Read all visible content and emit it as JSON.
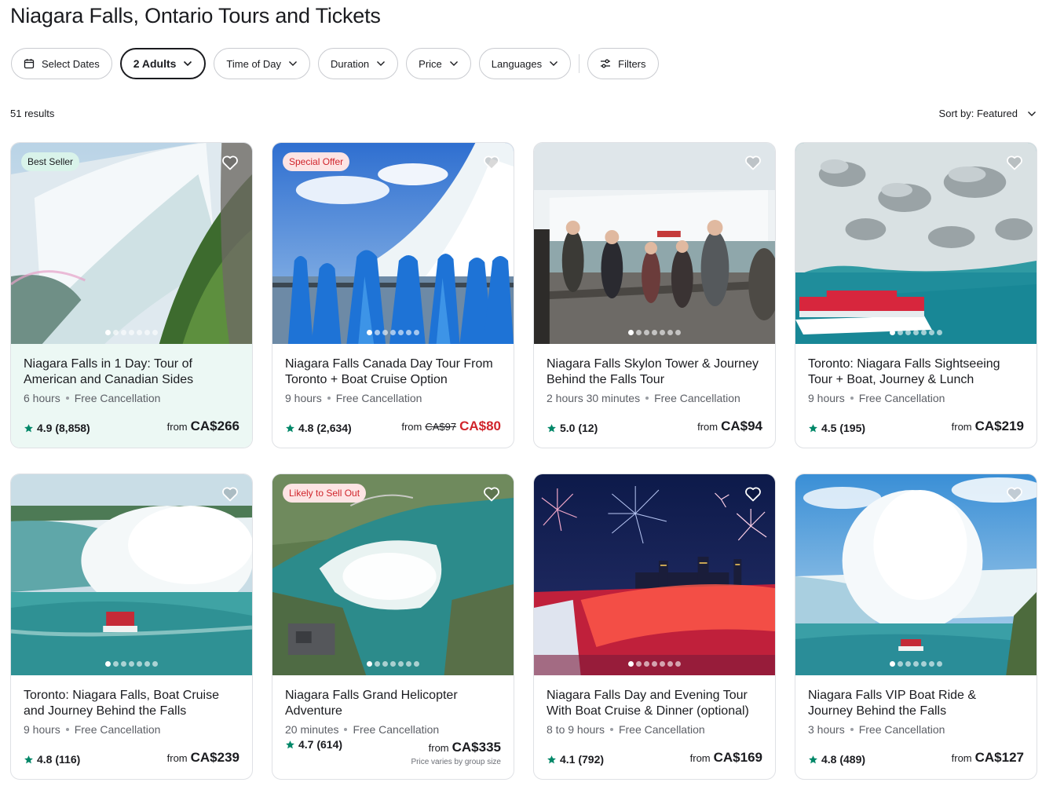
{
  "page_title": "Niagara Falls, Ontario Tours and Tickets",
  "filters": {
    "select_dates": "Select Dates",
    "adults": "2 Adults",
    "time_of_day": "Time of Day",
    "duration": "Duration",
    "price": "Price",
    "languages": "Languages",
    "more": "Filters"
  },
  "results": {
    "count_text": "51 results",
    "sort_text": "Sort by: Featured"
  },
  "colors": {
    "accent_green": "#008768",
    "sale_red": "#d0242b",
    "best_seller_bg": "#d9f3ea",
    "offer_bg": "#fde4e4",
    "highlight_bg": "#ecf8f4"
  },
  "cards": [
    {
      "badge": "Best Seller",
      "title": "Niagara Falls in 1 Day: Tour of American and Canadian Sides",
      "duration": "6 hours",
      "cancel": "Free Cancellation",
      "rating": "4.9",
      "reviews": "(8,858)",
      "from": "from",
      "price": "CA$266",
      "old_price": "",
      "note": ""
    },
    {
      "badge": "Special Offer",
      "title": "Niagara Falls Canada Day Tour From Toronto + Boat Cruise Option",
      "duration": "9 hours",
      "cancel": "Free Cancellation",
      "rating": "4.8",
      "reviews": "(2,634)",
      "from": "from",
      "price": "CA$80",
      "old_price": "CA$97",
      "note": ""
    },
    {
      "badge": "",
      "title": "Niagara Falls Skylon Tower & Journey Behind the Falls Tour",
      "duration": "2 hours 30 minutes",
      "cancel": "Free Cancellation",
      "rating": "5.0",
      "reviews": "(12)",
      "from": "from",
      "price": "CA$94",
      "old_price": "",
      "note": ""
    },
    {
      "badge": "",
      "title": "Toronto: Niagara Falls Sightseeing Tour + Boat, Journey & Lunch",
      "duration": "9 hours",
      "cancel": "Free Cancellation",
      "rating": "4.5",
      "reviews": "(195)",
      "from": "from",
      "price": "CA$219",
      "old_price": "",
      "note": ""
    },
    {
      "badge": "",
      "title": "Toronto: Niagara Falls, Boat Cruise and Journey Behind the Falls",
      "duration": "9 hours",
      "cancel": "Free Cancellation",
      "rating": "4.8",
      "reviews": "(116)",
      "from": "from",
      "price": "CA$239",
      "old_price": "",
      "note": ""
    },
    {
      "badge": "Likely to Sell Out",
      "title": "Niagara Falls Grand Helicopter Adventure",
      "duration": "20 minutes",
      "cancel": "Free Cancellation",
      "rating": "4.7",
      "reviews": "(614)",
      "from": "from",
      "price": "CA$335",
      "old_price": "",
      "note": "Price varies by group size"
    },
    {
      "badge": "",
      "title": "Niagara Falls Day and Evening Tour With Boat Cruise & Dinner (optional)",
      "duration": "8 to 9 hours",
      "cancel": "Free Cancellation",
      "rating": "4.1",
      "reviews": "(792)",
      "from": "from",
      "price": "CA$169",
      "old_price": "",
      "note": ""
    },
    {
      "badge": "",
      "title": "Niagara Falls VIP Boat Ride & Journey Behind the Falls",
      "duration": "3 hours",
      "cancel": "Free Cancellation",
      "rating": "4.8",
      "reviews": "(489)",
      "from": "from",
      "price": "CA$127",
      "old_price": "",
      "note": ""
    }
  ]
}
